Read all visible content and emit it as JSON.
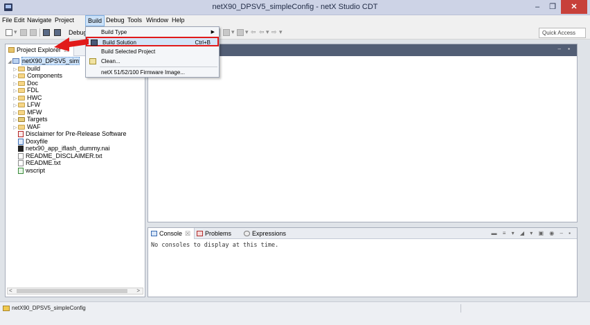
{
  "window": {
    "title": "netX90_DPSV5_simpleConfig - netX Studio CDT",
    "minimize_glyph": "–",
    "restore_glyph": "❐",
    "close_glyph": "✕"
  },
  "menubar": {
    "items": [
      "File",
      "Edit",
      "Navigate",
      "Project",
      "Build",
      "Debug",
      "Tools",
      "Window",
      "Help"
    ],
    "active": "Build"
  },
  "toolbar": {
    "debug_label": "Debug",
    "quick_access_placeholder": "Quick Access"
  },
  "build_menu": {
    "items": [
      {
        "label": "Build Type",
        "shortcut": "",
        "submenu": true,
        "icon": ""
      },
      {
        "label": "Build Solution",
        "shortcut": "Ctrl+B",
        "submenu": false,
        "icon": "build-icon",
        "highlighted": true
      },
      {
        "label": "Build Selected Project",
        "shortcut": "",
        "submenu": false,
        "icon": ""
      },
      {
        "label": "Clean...",
        "shortcut": "",
        "submenu": false,
        "icon": "clean-icon"
      },
      {
        "label": "netX 51/52/100 Firmware Image...",
        "shortcut": "",
        "submenu": false,
        "icon": ""
      }
    ]
  },
  "project_explorer": {
    "tab_label": "Project Explorer",
    "tab_close": "☒",
    "project": "netX90_DPSV5_sim",
    "folders": [
      "build",
      "Components",
      "Doc",
      "FDL",
      "HWC",
      "LFW",
      "MFW",
      "Targets",
      "WAF"
    ],
    "files": [
      {
        "name": "Disclaimer for Pre-Release Software",
        "icon": "pdf-icon"
      },
      {
        "name": "Doxyfile",
        "icon": "doxyfile-icon"
      },
      {
        "name": "netx90_app_iflash_dummy.nai",
        "icon": "binary-file-icon"
      },
      {
        "name": "README_DISCLAIMER.txt",
        "icon": "text-file-icon"
      },
      {
        "name": "README.txt",
        "icon": "text-file-icon"
      },
      {
        "name": "wscript",
        "icon": "script-file-icon"
      }
    ]
  },
  "console": {
    "tabs": [
      {
        "label": "Console",
        "close": "☒",
        "active": true
      },
      {
        "label": "Problems",
        "close": "",
        "active": false
      },
      {
        "label": "Expressions",
        "close": "",
        "active": false
      }
    ],
    "message": "No consoles to display at this time."
  },
  "statusbar": {
    "text": "netX90_DPSV5_simpleConfig"
  },
  "colors": {
    "highlight_border": "#e11a1a",
    "title_bg": "#cdd3e6",
    "close_btn": "#c7403a",
    "editor_header": "#525e75"
  }
}
